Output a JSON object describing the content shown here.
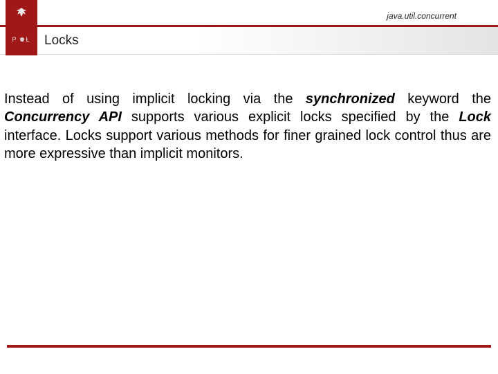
{
  "header": {
    "package_label": "java.util.concurrent"
  },
  "title": "Locks",
  "body": {
    "pre_sync": "Instead of using implicit locking via the ",
    "sync": "synchronized",
    "post_sync_pre_api": " keyword the ",
    "api": "Concurrency API",
    "post_api_pre_lock": " supports various explicit locks specified by the ",
    "lock": "Lock",
    "post_lock": " interface. Locks support various methods for finer grained lock control thus are more expressive than implicit monitors."
  },
  "brand": {
    "left_letter": "P",
    "right_letter": "Ł"
  },
  "colors": {
    "accent": "#a01818"
  }
}
